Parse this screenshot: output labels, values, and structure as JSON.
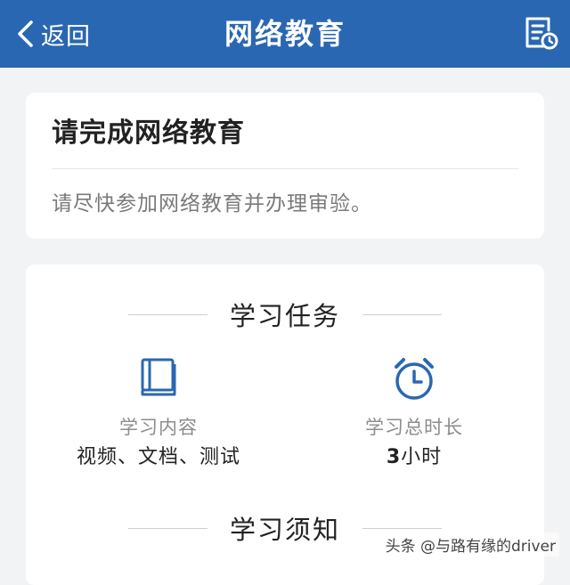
{
  "colors": {
    "nav_bg": "#2a67b2",
    "accent": "#2a67b2",
    "page_bg": "#f2f3f5"
  },
  "navbar": {
    "back_label": "返回",
    "back_icon": "chevron-left-icon",
    "title": "网络教育",
    "record_icon": "document-clock-icon"
  },
  "notice_card": {
    "title": "请完成网络教育",
    "description": "请尽快参加网络教育并办理审验。"
  },
  "task_card": {
    "section_title": "学习任务",
    "items": [
      {
        "icon": "book-icon",
        "label": "学习内容",
        "value": "视频、文档、测试"
      },
      {
        "icon": "alarm-clock-icon",
        "label": "学习总时长",
        "value": "3小时"
      }
    ],
    "notes_title": "学习须知"
  },
  "watermark": "头条 @与路有缘的driver"
}
